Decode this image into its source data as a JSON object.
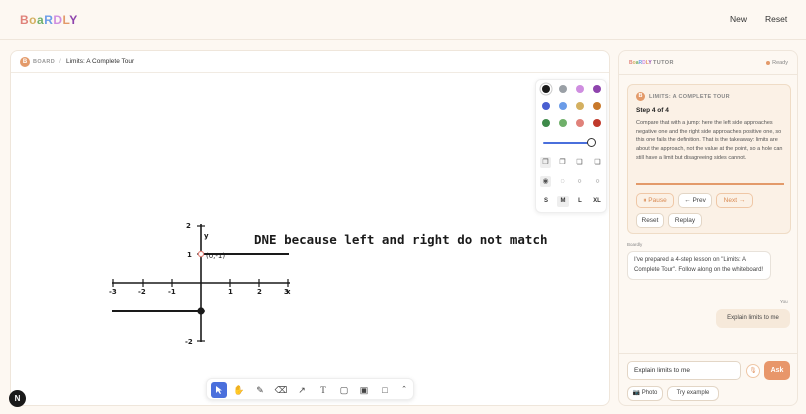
{
  "app": {
    "logo": "BoaRDLY",
    "nav_new": "New",
    "nav_reset": "Reset"
  },
  "board": {
    "badge": "B",
    "section_label": "BOARD",
    "separator": "/",
    "title": "Limits: A Complete Tour",
    "corner_badge": "N",
    "sketch": {
      "x_ticks": [
        "-3",
        "-2",
        "-1",
        "1",
        "2",
        "3"
      ],
      "y_ticks": [
        "2",
        "1",
        "-2"
      ],
      "x_label": "x",
      "y_label": "y",
      "point_label": "(0,-1)",
      "annotation": "DNE because left and right do not match"
    }
  },
  "palette": {
    "colors": [
      "#1a1a1a",
      "#9aa0a6",
      "#cf8ee0",
      "#8e44ad",
      "#4a5fd1",
      "#6b9ce8",
      "#d4b060",
      "#c8782a",
      "#3e8a4a",
      "#6fb06a",
      "#e0827a",
      "#c0392b"
    ],
    "sizes": [
      "S",
      "M",
      "L",
      "XL"
    ],
    "selected_size": "M",
    "stroke_width": 0.92
  },
  "toolbar": {
    "tools": [
      "select-icon",
      "hand-icon",
      "pencil-icon",
      "eraser-icon",
      "arrow-icon",
      "text-icon",
      "sticky-note-icon",
      "image-icon",
      "rectangle-icon",
      "chevron-up-icon"
    ],
    "active_tool": "select-icon"
  },
  "tutor": {
    "logo": "BoaRDLY",
    "label": "TUTOR",
    "status": "Ready",
    "status_color": "#e39a6a",
    "lesson": {
      "badge": "B",
      "title": "LIMITS: A COMPLETE TOUR",
      "step": "Step 4 of 4",
      "body": "Compare that with a jump: here the left side approaches negative one and the right side approaches positive one, so this one fails the definition. That is the takeaway: limits are about the approach, not the value at the point, so a hole can still have a limit but disagreeing sides cannot.",
      "progress": 1.0,
      "pause_label": "⏸ Pause",
      "prev_label": "← Prev",
      "next_label": "Next →",
      "reset_label": "Reset",
      "replay_label": "Replay"
    },
    "messages": [
      {
        "from": "Boardly",
        "text": "I've prepared a 4-step lesson on \"Limits: A Complete Tour\". Follow along on the whiteboard!"
      },
      {
        "from": "You",
        "text": "Explain limits to me"
      }
    ],
    "input": {
      "value": "Explain limits to me",
      "mic_icon": "🎙",
      "ask_label": "Ask",
      "photo_label": "📷 Photo",
      "try_label": "Try example"
    }
  }
}
